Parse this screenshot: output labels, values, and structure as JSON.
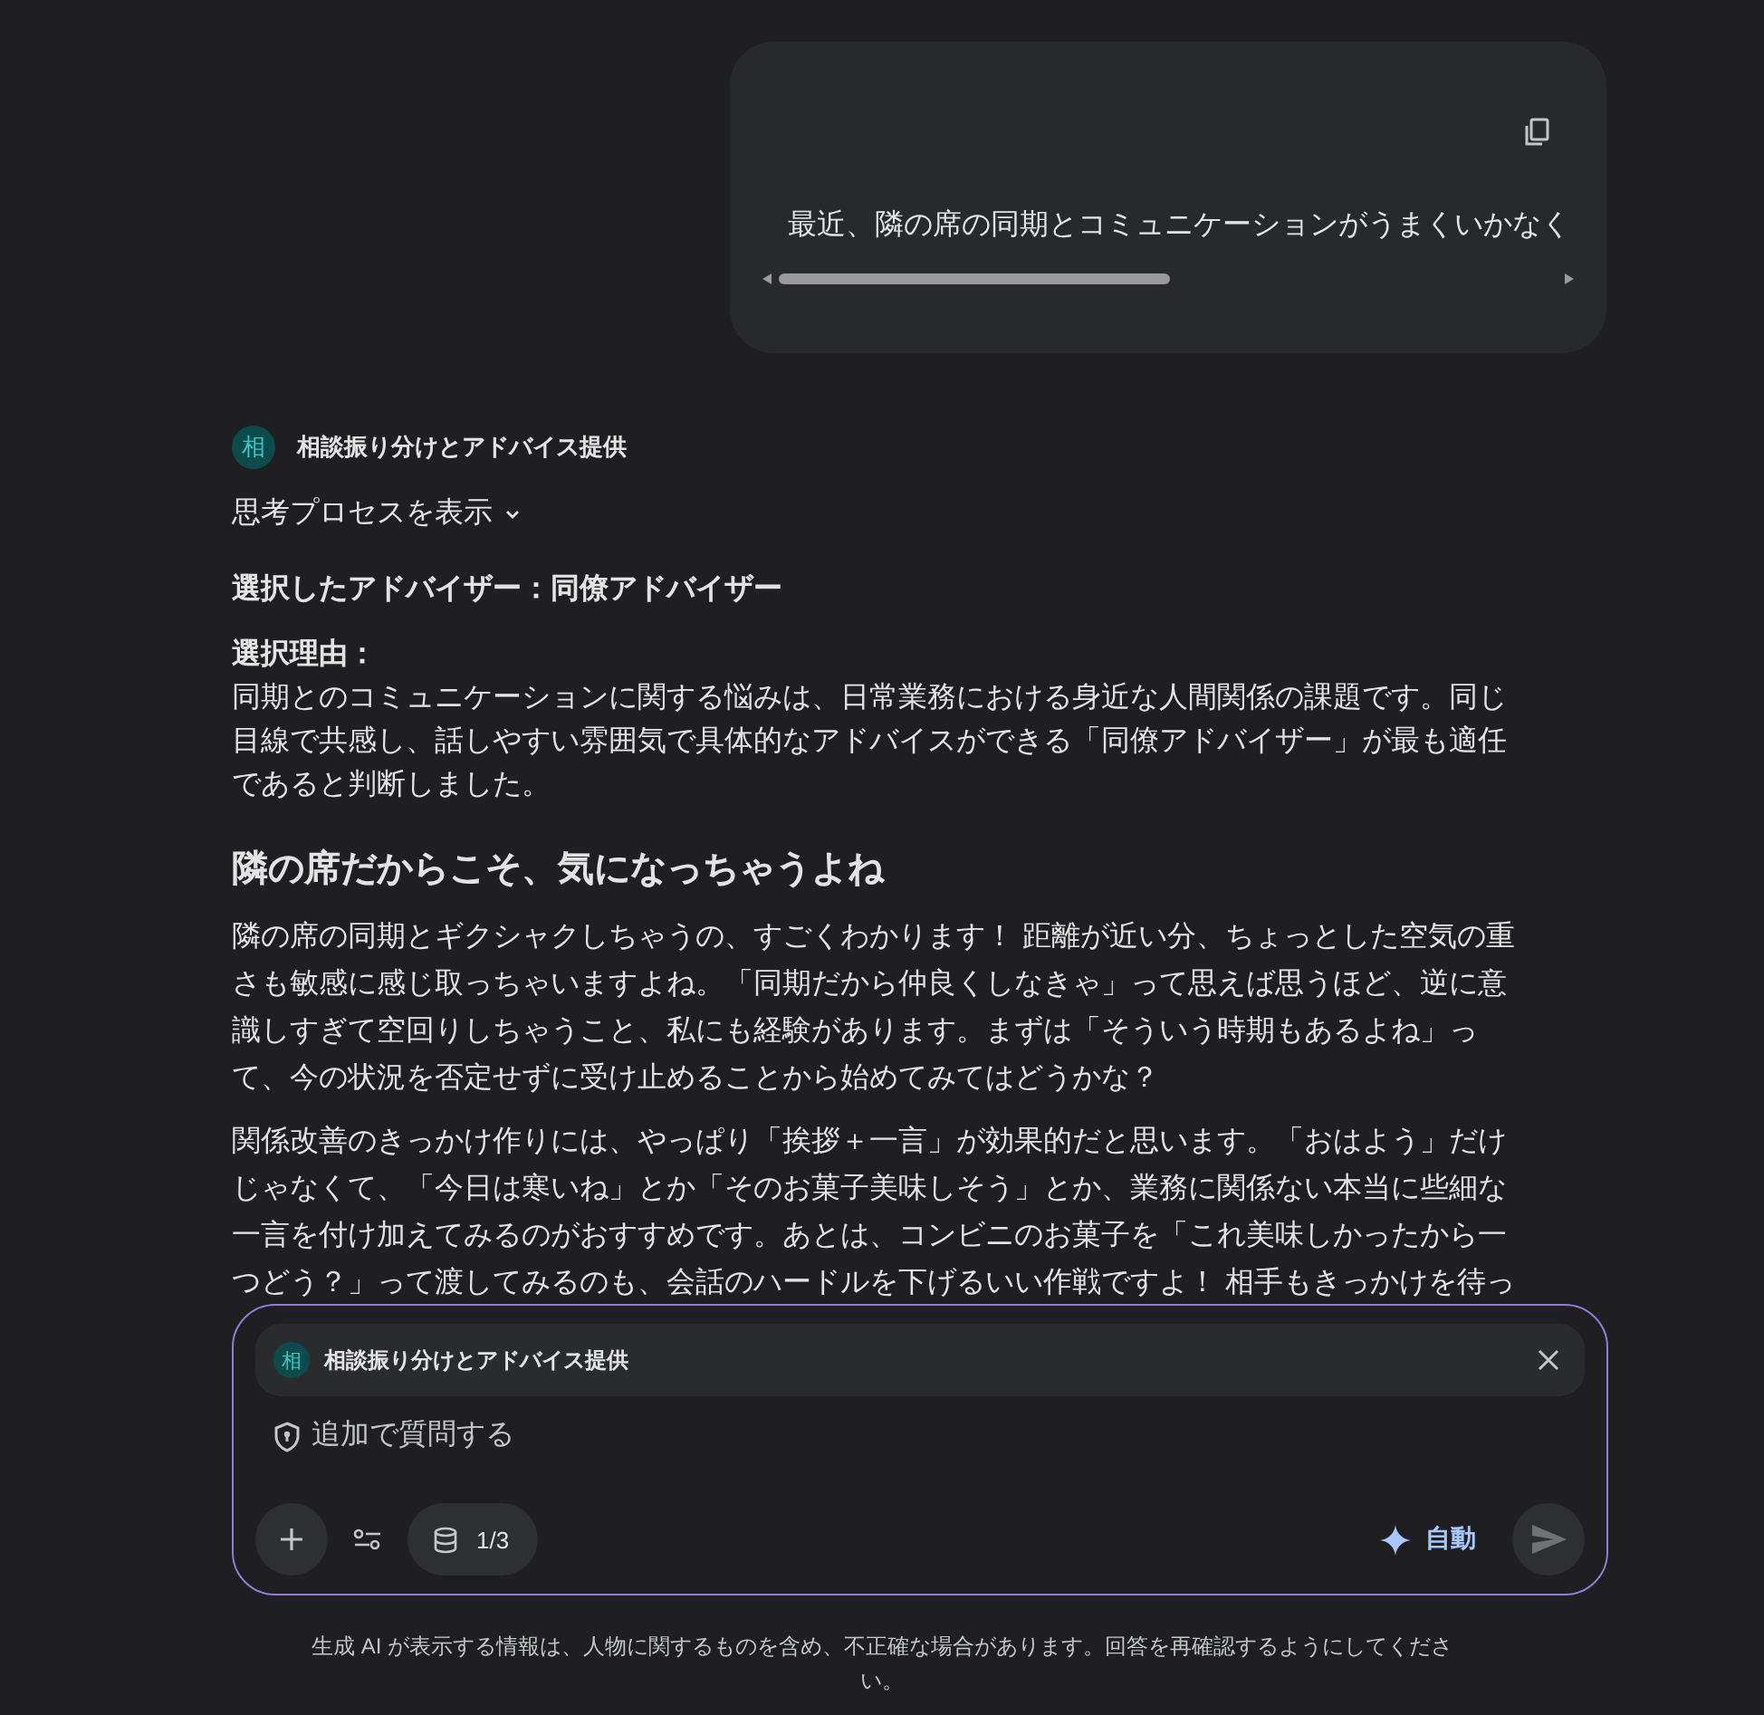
{
  "user_message": {
    "text": "最近、隣の席の同期とコミュニケーションがうまくいかなく"
  },
  "response": {
    "avatar": "相",
    "agent": "相談振り分けとアドバイス提供",
    "thinking_toggle": {
      "label": "思考プロセスを表示",
      "expanded": false
    },
    "selected_line": "選択したアドバイザー：同僚アドバイザー",
    "reason_label": "選択理由：",
    "reason_text": "同期とのコミュニケーションに関する悩みは、日常業務における身近な人間関係の課題です。同じ目線で共感し、話しやすい雰囲気で具体的なアドバイスができる「同僚アドバイザー」が最も適任であると判断しました。",
    "heading": "隣の席だからこそ、気になっちゃうよね",
    "paragraphs": [
      "隣の席の同期とギクシャクしちゃうの、すごくわかります！ 距離が近い分、ちょっとした空気の重さも敏感に感じ取っちゃいますよね。「同期だから仲良くしなきゃ」って思えば思うほど、逆に意識しすぎて空回りしちゃうこと、私にも経験があります。まずは「そういう時期もあるよね」って、今の状況を否定せずに受け止めることから始めてみてはどうかな？",
      "関係改善のきっかけ作りには、やっぱり「挨拶＋一言」が効果的だと思います。「おはよう」だけじゃなくて、「今日は寒いね」とか「そのお菓子美味しそう」とか、業務に関係ない本当に些細な一言を付け加えてみるのがおすすめです。あとは、コンビニのお菓子を「これ美味しかったから一つどう？」って渡してみるのも、会話のハードルを下げるいい作戦ですよ！ 相手もきっかけを待っ"
    ]
  },
  "composer": {
    "chip": {
      "avatar": "相",
      "label": "相談振り分けとアドバイス提供"
    },
    "placeholder": "追加で質問する",
    "source_count": "1/3",
    "mode": "自動"
  },
  "footer": "生成 AI が表示する情報は、人物に関するものを含め、不正確な場合があります。回答を再確認するようにしてください。"
}
